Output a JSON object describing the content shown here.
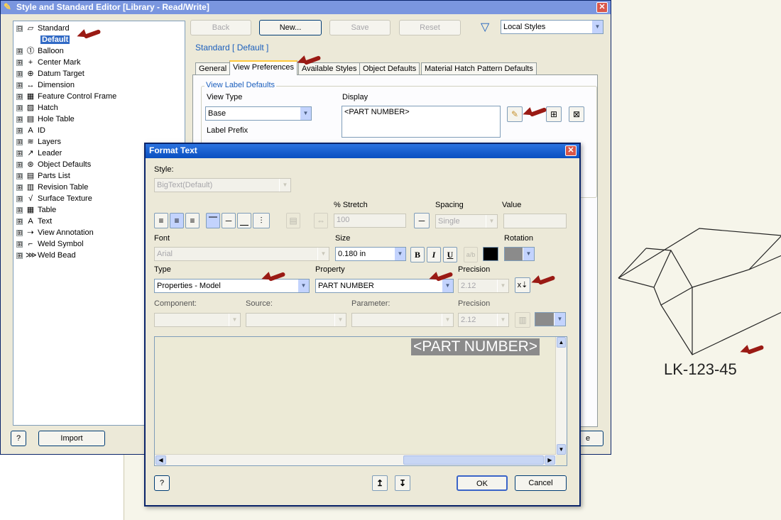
{
  "editor_window": {
    "title": "Style and Standard Editor [Library - Read/Write]",
    "close_glyph": "✕",
    "tree": [
      {
        "label": "Standard",
        "expander": "⊟",
        "icon": "▱"
      },
      {
        "label": "Default",
        "selected": true
      },
      {
        "label": "Balloon",
        "expander": "⊞",
        "icon": "⓵"
      },
      {
        "label": "Center Mark",
        "expander": "⊞",
        "icon": "+"
      },
      {
        "label": "Datum Target",
        "expander": "⊞",
        "icon": "⊕"
      },
      {
        "label": "Dimension",
        "expander": "⊞",
        "icon": "↔"
      },
      {
        "label": "Feature Control Frame",
        "expander": "⊞",
        "icon": "▦"
      },
      {
        "label": "Hatch",
        "expander": "⊞",
        "icon": "▨"
      },
      {
        "label": "Hole Table",
        "expander": "⊞",
        "icon": "▤"
      },
      {
        "label": "ID",
        "expander": "⊞",
        "icon": "A"
      },
      {
        "label": "Layers",
        "expander": "⊞",
        "icon": "≋"
      },
      {
        "label": "Leader",
        "expander": "⊞",
        "icon": "↗"
      },
      {
        "label": "Object Defaults",
        "expander": "⊞",
        "icon": "⊛"
      },
      {
        "label": "Parts List",
        "expander": "⊞",
        "icon": "▤"
      },
      {
        "label": "Revision Table",
        "expander": "⊞",
        "icon": "▥"
      },
      {
        "label": "Surface Texture",
        "expander": "⊞",
        "icon": "√"
      },
      {
        "label": "Table",
        "expander": "⊞",
        "icon": "▦"
      },
      {
        "label": "Text",
        "expander": "⊞",
        "icon": "A"
      },
      {
        "label": "View Annotation",
        "expander": "⊞",
        "icon": "⇢"
      },
      {
        "label": "Weld Symbol",
        "expander": "⊞",
        "icon": "⌐"
      },
      {
        "label": "Weld Bead",
        "expander": "⊞",
        "icon": "⋙"
      }
    ],
    "buttons": {
      "back": "Back",
      "new": "New...",
      "save": "Save",
      "reset": "Reset",
      "import": "Import",
      "help": "?"
    },
    "filter_value": "Local Styles",
    "breadcrumb": "Standard [ Default ]",
    "tabs": [
      "General",
      "View Preferences",
      "Available Styles",
      "Object Defaults",
      "Material Hatch Pattern Defaults"
    ],
    "active_tab": "View Preferences",
    "view_label_defaults": {
      "group_label": "View Label Defaults",
      "view_type_label": "View Type",
      "view_type_value": "Base",
      "label_prefix_label": "Label Prefix",
      "display_label": "Display",
      "display_value": "<PART NUMBER>"
    },
    "partial_button_text": "e"
  },
  "format_text": {
    "title": "Format Text",
    "style_label": "Style:",
    "style_value": "BigText(Default)",
    "stretch_label": "% Stretch",
    "stretch_value": "100",
    "spacing_label": "Spacing",
    "spacing_value": "Single",
    "value_label": "Value",
    "font_label": "Font",
    "font_value": "Arial",
    "size_label": "Size",
    "size_value": "0.180 in",
    "rotation_label": "Rotation",
    "bold": "B",
    "italic": "I",
    "underline": "U",
    "type_label": "Type",
    "type_value": "Properties - Model",
    "property_label": "Property",
    "property_value": "PART NUMBER",
    "precision_label": "Precision",
    "precision_value": "2.12",
    "component_label": "Component:",
    "source_label": "Source:",
    "parameter_label": "Parameter:",
    "precision2_label": "Precision",
    "precision2_value": "2.12",
    "field_text": "<PART NUMBER>",
    "ok": "OK",
    "cancel": "Cancel",
    "help": "?"
  },
  "drawing": {
    "part_label": "LK-123-45"
  },
  "colors": {
    "accent": "#1b5fbd",
    "title_active": "#0a4fc0",
    "title_inactive": "#7a96df",
    "annotation_arrow": "#9a1a14"
  }
}
